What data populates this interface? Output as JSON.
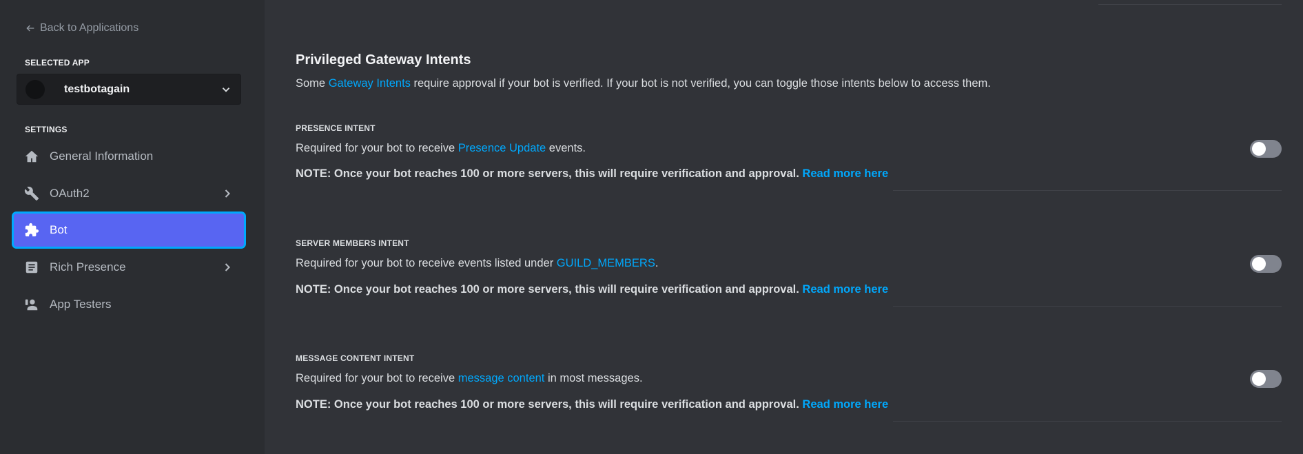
{
  "sidebar": {
    "back_label": "Back to Applications",
    "selected_app_heading": "SELECTED APP",
    "app_name": "testbotagain",
    "settings_heading": "SETTINGS",
    "items": [
      {
        "label": "General Information",
        "icon": "home-icon"
      },
      {
        "label": "OAuth2",
        "icon": "wrench-icon",
        "has_submenu": true
      },
      {
        "label": "Bot",
        "icon": "puzzle-icon",
        "active": true
      },
      {
        "label": "Rich Presence",
        "icon": "document-icon",
        "has_submenu": true
      },
      {
        "label": "App Testers",
        "icon": "person-icon"
      }
    ]
  },
  "main": {
    "title": "Privileged Gateway Intents",
    "desc_prefix": "Some ",
    "desc_link": "Gateway Intents",
    "desc_suffix": " require approval if your bot is verified. If your bot is not verified, you can toggle those intents below to access them.",
    "intents": [
      {
        "label": "PRESENCE INTENT",
        "desc_prefix": "Required for your bot to receive ",
        "desc_link": "Presence Update",
        "desc_suffix": " events.",
        "note": "NOTE: Once your bot reaches 100 or more servers, this will require verification and approval.",
        "note_link": "Read more here",
        "enabled": false
      },
      {
        "label": "SERVER MEMBERS INTENT",
        "desc_prefix": "Required for your bot to receive events listed under ",
        "desc_link": "GUILD_MEMBERS",
        "desc_suffix": ".",
        "note": "NOTE: Once your bot reaches 100 or more servers, this will require verification and approval.",
        "note_link": "Read more here",
        "enabled": false
      },
      {
        "label": "MESSAGE CONTENT INTENT",
        "desc_prefix": "Required for your bot to receive ",
        "desc_link": "message content",
        "desc_suffix": " in most messages.",
        "note": "NOTE: Once your bot reaches 100 or more servers, this will require verification and approval.",
        "note_link": "Read more here",
        "enabled": false
      }
    ]
  },
  "colors": {
    "accent": "#5865f2",
    "link": "#00a8fc",
    "focus_ring": "#00a8fc",
    "toggle_off": "#80848e"
  }
}
